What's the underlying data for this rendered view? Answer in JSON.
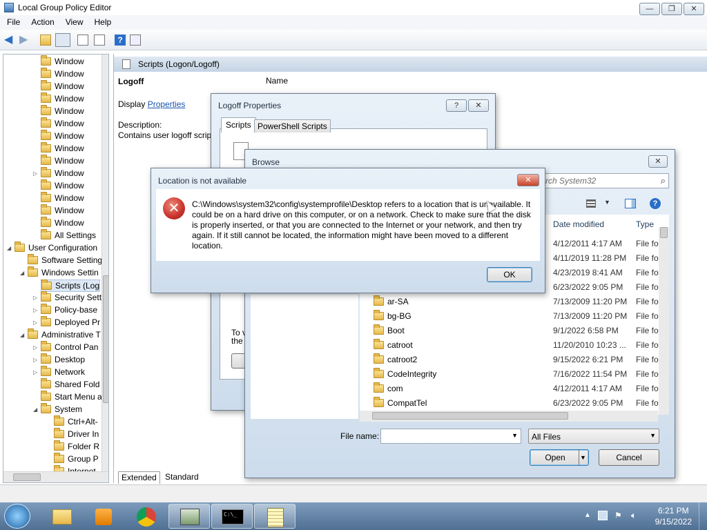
{
  "main_window": {
    "title": "Local Group Policy Editor",
    "menu": [
      "File",
      "Action",
      "View",
      "Help"
    ],
    "tree": [
      {
        "label": "Window",
        "indent": 2
      },
      {
        "label": "Window",
        "indent": 2
      },
      {
        "label": "Window",
        "indent": 2
      },
      {
        "label": "Window",
        "indent": 2
      },
      {
        "label": "Window",
        "indent": 2
      },
      {
        "label": "Window",
        "indent": 2
      },
      {
        "label": "Window",
        "indent": 2
      },
      {
        "label": "Window",
        "indent": 2
      },
      {
        "label": "Window",
        "indent": 2
      },
      {
        "label": "Window",
        "indent": 2
      },
      {
        "label": "Window",
        "indent": 2
      },
      {
        "label": "Window",
        "indent": 2
      },
      {
        "label": "Window",
        "indent": 2
      },
      {
        "label": "Window",
        "indent": 2
      },
      {
        "label": "All Settings",
        "indent": 2
      },
      {
        "label": "User Configuration",
        "indent": 0
      },
      {
        "label": "Software Setting",
        "indent": 1
      },
      {
        "label": "Windows Settin",
        "indent": 1
      },
      {
        "label": "Scripts (Log",
        "indent": 2
      },
      {
        "label": "Security Sett",
        "indent": 2
      },
      {
        "label": "Policy-base",
        "indent": 2
      },
      {
        "label": "Deployed Pr",
        "indent": 2
      },
      {
        "label": "Administrative T",
        "indent": 1
      },
      {
        "label": "Control Pan",
        "indent": 2
      },
      {
        "label": "Desktop",
        "indent": 2
      },
      {
        "label": "Network",
        "indent": 2
      },
      {
        "label": "Shared Fold",
        "indent": 2
      },
      {
        "label": "Start Menu a",
        "indent": 2
      },
      {
        "label": "System",
        "indent": 2
      },
      {
        "label": "Ctrl+Alt-",
        "indent": 3
      },
      {
        "label": "Driver In",
        "indent": 3
      },
      {
        "label": "Folder R",
        "indent": 3
      },
      {
        "label": "Group P",
        "indent": 3
      },
      {
        "label": "Internet",
        "indent": 3
      }
    ],
    "right_header": "Scripts (Logon/Logoff)",
    "section_title": "Logoff",
    "display_label": "Display",
    "properties_link": "Properties",
    "description_label": "Description:",
    "description_text": "Contains user logoff scrip",
    "column_name": "Name",
    "tabs": [
      "Extended",
      "Standard"
    ]
  },
  "logoff_dialog": {
    "title": "Logoff Properties",
    "tabs": [
      "Scripts",
      "PowerShell Scripts"
    ],
    "partial_text_1": "To v",
    "partial_text_2": "the b"
  },
  "browse_dialog": {
    "title": "Browse",
    "search_placeholder": "rch System32",
    "col_date": "Date modified",
    "col_type": "Type",
    "rows": [
      {
        "name": "",
        "date": "4/12/2011 4:17 AM",
        "type": "File fol"
      },
      {
        "name": "",
        "date": "4/11/2019 11:28 PM",
        "type": "File fol"
      },
      {
        "name": "",
        "date": "4/23/2019 8:41 AM",
        "type": "File fol"
      },
      {
        "name": "",
        "date": "6/23/2022 9:05 PM",
        "type": "File fol"
      },
      {
        "name": "ar-SA",
        "date": "7/13/2009 11:20 PM",
        "type": "File fol"
      },
      {
        "name": "bg-BG",
        "date": "7/13/2009 11:20 PM",
        "type": "File fol"
      },
      {
        "name": "Boot",
        "date": "9/1/2022 6:58 PM",
        "type": "File fol"
      },
      {
        "name": "catroot",
        "date": "11/20/2010 10:23 ...",
        "type": "File fol"
      },
      {
        "name": "catroot2",
        "date": "9/15/2022 6:21 PM",
        "type": "File fol"
      },
      {
        "name": "CodeIntegrity",
        "date": "7/16/2022 11:54 PM",
        "type": "File fol"
      },
      {
        "name": "com",
        "date": "4/12/2011 4:17 AM",
        "type": "File fol"
      },
      {
        "name": "CompatTel",
        "date": "6/23/2022 9:05 PM",
        "type": "File fol"
      }
    ],
    "file_name_label": "File name:",
    "file_name_value": "",
    "filter_value": "All Files",
    "open_label": "Open",
    "cancel_label": "Cancel"
  },
  "error_dialog": {
    "title": "Location is not available",
    "message": "C:\\Windows\\system32\\config\\systemprofile\\Desktop refers to a location that is unavailable. It could be on a hard drive on this computer, or on a network. Check to make sure that the disk is properly inserted, or that you are connected to the Internet or your network, and then try again. If it still cannot be located, the information might have been moved to a different location.",
    "ok_label": "OK"
  },
  "taskbar": {
    "time": "6:21 PM",
    "date": "9/15/2022"
  },
  "colors": {
    "accent": "#4f6f93",
    "error": "#c8322b",
    "link": "#1a55b0"
  }
}
